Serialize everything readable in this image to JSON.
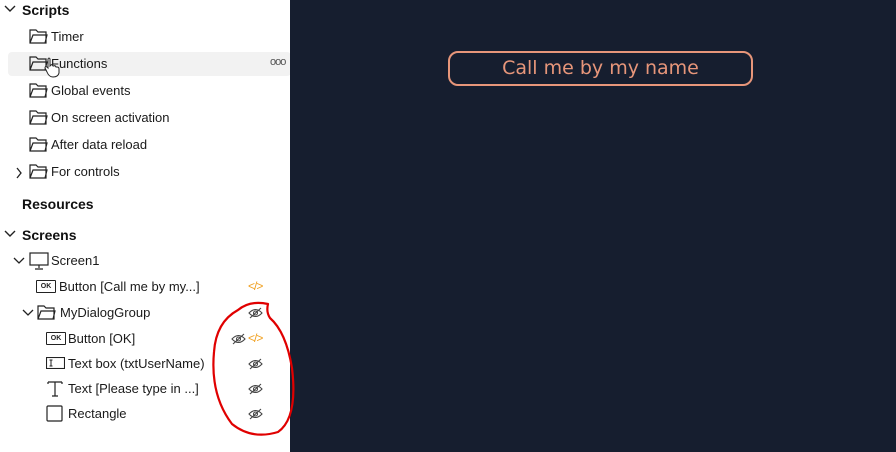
{
  "sections": {
    "scripts": "Scripts",
    "resources": "Resources",
    "screens": "Screens"
  },
  "scripts": {
    "timer": "Timer",
    "functions": "Functions",
    "global_events": "Global events",
    "on_screen_activation": "On screen activation",
    "after_data_reload": "After data reload",
    "for_controls": "For controls",
    "more_menu": "ooo"
  },
  "screens": {
    "screen1": "Screen1",
    "button_call": "Button [Call me by my...]",
    "dialog_group": "MyDialogGroup",
    "button_ok": "Button [OK]",
    "textbox": "Text box  (txtUserName)",
    "text_please": "Text [Please type in ...]",
    "rectangle": "Rectangle"
  },
  "icons": {
    "ok_badge": "OK",
    "code": "</>"
  },
  "canvas": {
    "button_label": "Call me by my name"
  },
  "colors": {
    "canvas_bg": "#161e2f",
    "accent": "#e7967a",
    "code_icon": "#f0a020",
    "annotation": "#e00000"
  }
}
